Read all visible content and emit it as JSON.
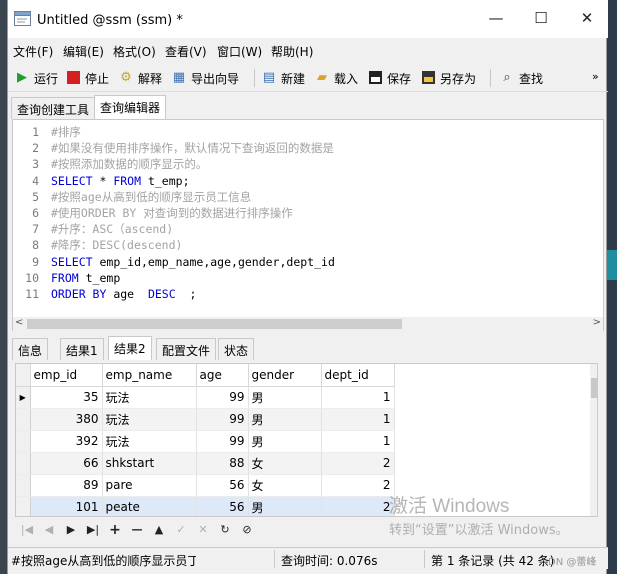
{
  "window": {
    "title": "Untitled @ssm (ssm) *",
    "min": "—",
    "max": "☐",
    "close": "✕"
  },
  "menu": [
    "文件(F)",
    "编辑(E)",
    "格式(O)",
    "查看(V)",
    "窗口(W)",
    "帮助(H)"
  ],
  "toolbar": {
    "run": "运行",
    "stop": "停止",
    "explain": "解释",
    "export": "导出向导",
    "new": "新建",
    "load": "载入",
    "save": "保存",
    "saveas": "另存为",
    "find": "查找",
    "more": "»"
  },
  "query_tabs": [
    "查询创建工具",
    "查询编辑器"
  ],
  "editor": {
    "lines": [
      {
        "n": "1",
        "parts": [
          {
            "c": "cm",
            "t": "#排序"
          }
        ]
      },
      {
        "n": "2",
        "parts": [
          {
            "c": "cm",
            "t": "#如果没有使用排序操作，默认情况下查询返回的数据是"
          }
        ]
      },
      {
        "n": "3",
        "parts": [
          {
            "c": "cm",
            "t": "#按照添加数据的顺序显示的。"
          }
        ]
      },
      {
        "n": "4",
        "parts": [
          {
            "c": "kw",
            "t": "SELECT"
          },
          {
            "c": "tx",
            "t": " * "
          },
          {
            "c": "kw",
            "t": "FROM"
          },
          {
            "c": "tx",
            "t": " t_emp;"
          }
        ]
      },
      {
        "n": "5",
        "parts": [
          {
            "c": "cm",
            "t": "#按照age从高到低的顺序显示员工信息"
          }
        ]
      },
      {
        "n": "6",
        "parts": [
          {
            "c": "cm",
            "t": "#使用ORDER BY 对查询到的数据进行排序操作"
          }
        ]
      },
      {
        "n": "7",
        "parts": [
          {
            "c": "cm",
            "t": "#升序：ASC（ascend)"
          }
        ]
      },
      {
        "n": "8",
        "parts": [
          {
            "c": "cm",
            "t": "#降序：DESC(descend)"
          }
        ]
      },
      {
        "n": "9",
        "parts": [
          {
            "c": "kw",
            "t": "SELECT"
          },
          {
            "c": "tx",
            "t": " emp_id,emp_name,age,gender,dept_id"
          }
        ]
      },
      {
        "n": "10",
        "parts": [
          {
            "c": "kw",
            "t": "FROM"
          },
          {
            "c": "tx",
            "t": " t_emp"
          }
        ]
      },
      {
        "n": "11",
        "parts": [
          {
            "c": "kw",
            "t": "ORDER BY"
          },
          {
            "c": "tx",
            "t": " age  "
          },
          {
            "c": "kw",
            "t": "DESC"
          },
          {
            "c": "tx",
            "t": "  ;"
          }
        ]
      }
    ]
  },
  "result_tabs": [
    "信息",
    "结果1",
    "结果2",
    "配置文件",
    "状态"
  ],
  "grid": {
    "columns": [
      "emp_id",
      "emp_name",
      "age",
      "gender",
      "dept_id"
    ],
    "rows": [
      [
        "35",
        "玩法",
        "99",
        "男",
        "1"
      ],
      [
        "380",
        "玩法",
        "99",
        "男",
        "1"
      ],
      [
        "392",
        "玩法",
        "99",
        "男",
        "1"
      ],
      [
        "66",
        "shkstart",
        "88",
        "女",
        "2"
      ],
      [
        "89",
        "pare",
        "56",
        "女",
        "2"
      ],
      [
        "101",
        "peate",
        "56",
        "男",
        "2"
      ]
    ]
  },
  "nav": [
    "|◀",
    "◀",
    "▶",
    "▶|",
    "+",
    "—",
    "▲",
    "✓",
    "✕",
    "↻",
    "⊘"
  ],
  "watermark": {
    "line1": "激活 Windows",
    "line2": "转到“设置”以激活 Windows。"
  },
  "status": {
    "sql": "#按照age从高到低的顺序显示员丁",
    "time": "查询时间: 0.076s",
    "record": "第 1 条记录 (共 42 条)",
    "credit": "DN @蕾峰"
  }
}
